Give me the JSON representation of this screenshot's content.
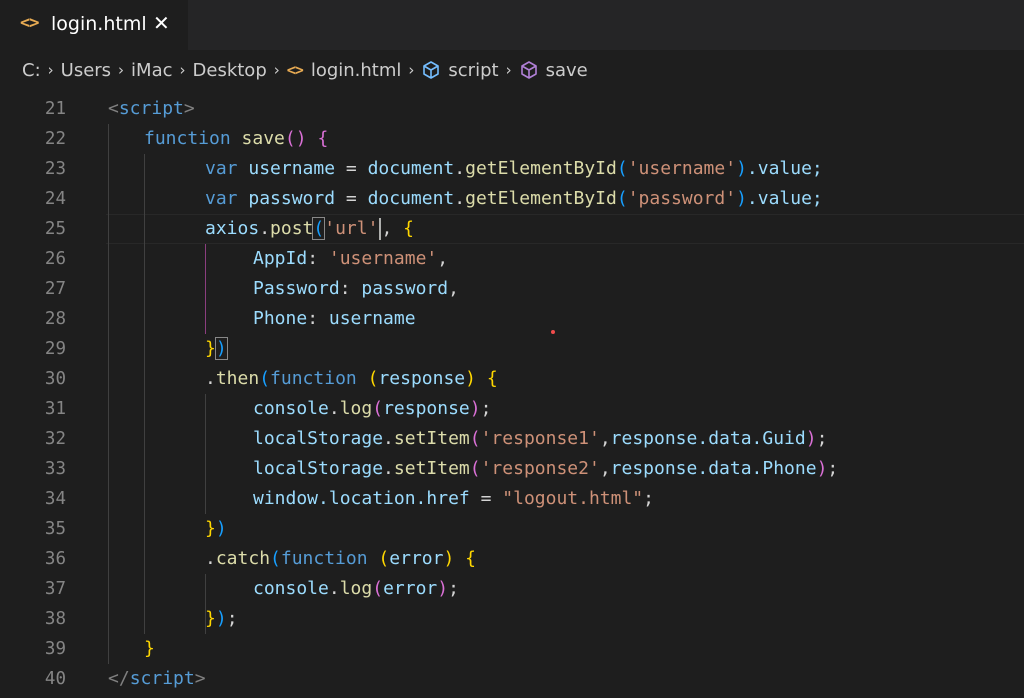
{
  "tab": {
    "icon": "<>",
    "label": "login.html",
    "close": "✕"
  },
  "breadcrumb": {
    "items": [
      "C:",
      "Users",
      "iMac",
      "Desktop",
      "login.html",
      "script",
      "save"
    ],
    "separator": "›"
  },
  "editor": {
    "line_numbers": [
      "21",
      "22",
      "23",
      "24",
      "25",
      "26",
      "27",
      "28",
      "29",
      "30",
      "31",
      "32",
      "33",
      "34",
      "35",
      "36",
      "37",
      "38",
      "39",
      "40"
    ],
    "tokens": {
      "l21_open": "<",
      "l21_tag": "script",
      "l21_close": ">",
      "l22_kw": "function",
      "l22_fn": "save",
      "l22_paren": "()",
      "l22_brace": "{",
      "l23_kw": "var",
      "l23_var": "username",
      "l23_eq": " = ",
      "l23_obj": "document",
      "l23_dot": ".",
      "l23_fn": "getElementById",
      "l23_p1": "(",
      "l23_str": "'username'",
      "l23_p2": ")",
      "l23_rest": ".value;",
      "l24_kw": "var",
      "l24_var": "password",
      "l24_eq": " = ",
      "l24_obj": "document",
      "l24_dot": ".",
      "l24_fn": "getElementById",
      "l24_p1": "(",
      "l24_str": "'password'",
      "l24_p2": ")",
      "l24_rest": ".value;",
      "l25_obj": "axios",
      "l25_dot": ".",
      "l25_fn": "post",
      "l25_p1": "(",
      "l25_str1": "'url",
      "l25_str2": "'",
      "l25_comma": ", ",
      "l25_brace": "{",
      "l26_key": "AppId",
      "l26_colon": ": ",
      "l26_str": "'username'",
      "l26_comma": ",",
      "l27_key": "Password",
      "l27_colon": ": ",
      "l27_var": "password",
      "l27_comma": ",",
      "l28_key": "Phone",
      "l28_colon": ": ",
      "l28_var": "username",
      "l29_brace": "}",
      "l29_paren": ")",
      "l30_dot": ".",
      "l30_fn": "then",
      "l30_p1": "(",
      "l30_kw": "function",
      "l30_sp": " ",
      "l30_p2": "(",
      "l30_var": "response",
      "l30_p3": ")",
      "l30_sp2": " ",
      "l30_brace": "{",
      "l31_obj": "console",
      "l31_dot": ".",
      "l31_fn": "log",
      "l31_p1": "(",
      "l31_var": "response",
      "l31_p2": ")",
      "l31_semi": ";",
      "l32_obj": "localStorage",
      "l32_dot": ".",
      "l32_fn": "setItem",
      "l32_p1": "(",
      "l32_str": "'response1'",
      "l32_comma": ",",
      "l32_var": "response.data.Guid",
      "l32_p2": ")",
      "l32_semi": ";",
      "l33_obj": "localStorage",
      "l33_dot": ".",
      "l33_fn": "setItem",
      "l33_p1": "(",
      "l33_str": "'response2'",
      "l33_comma": ",",
      "l33_var": "response.data.Phone",
      "l33_p2": ")",
      "l33_semi": ";",
      "l34_var": "window.location.href",
      "l34_eq": " = ",
      "l34_str": "\"logout.html\"",
      "l34_semi": ";",
      "l35_brace": "}",
      "l35_paren": ")",
      "l36_dot": ".",
      "l36_fn": "catch",
      "l36_p1": "(",
      "l36_kw": "function",
      "l36_sp": " ",
      "l36_p2": "(",
      "l36_var": "error",
      "l36_p3": ")",
      "l36_sp2": " ",
      "l36_brace": "{",
      "l37_obj": "console",
      "l37_dot": ".",
      "l37_fn": "log",
      "l37_p1": "(",
      "l37_var": "error",
      "l37_p2": ")",
      "l37_semi": ";",
      "l38_brace": "}",
      "l38_paren": ")",
      "l38_semi": ";",
      "l39_brace": "}",
      "l40_open": "</",
      "l40_tag": "script",
      "l40_close": ">"
    }
  }
}
